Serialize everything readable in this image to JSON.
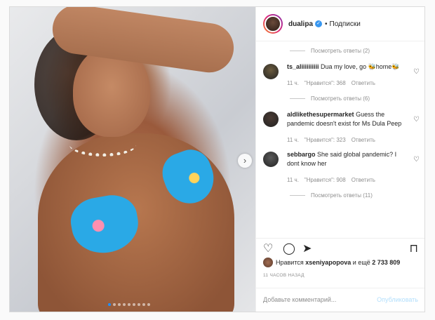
{
  "post": {
    "username": "dualipa",
    "verified_icon": "verified-badge-icon",
    "follow_separator": "•",
    "follow_label": "Подписки",
    "photo_dots": 9,
    "photo_active_index": 0
  },
  "comments": [
    {
      "type": "replies",
      "label": "Посмотреть ответы (2)"
    },
    {
      "type": "comment",
      "author": "ts_aliiiiiiiiii",
      "text": "Dua my love, go 🐝home🐝",
      "time": "11 ч.",
      "likes": "\"Нравится\": 368",
      "reply": "Ответить",
      "avatar_color": "#6b5b3e"
    },
    {
      "type": "replies",
      "label": "Посмотреть ответы (6)"
    },
    {
      "type": "comment",
      "author": "aldlikethesupermarket",
      "text": "Guess the pandemic doesn't exist for Ms Dula Peep",
      "time": "11 ч.",
      "likes": "\"Нравится\": 323",
      "reply": "Ответить",
      "avatar_color": "#4a3a33"
    },
    {
      "type": "comment",
      "author": "sebbargo",
      "text": "She said global pandemic? I dont know her",
      "time": "11 ч.",
      "likes": "\"Нравится\": 908",
      "reply": "Ответить",
      "avatar_color": "#5a5a5a"
    },
    {
      "type": "replies",
      "label": "Посмотреть ответы (11)"
    }
  ],
  "actions": {
    "like_icon": "heart-icon",
    "comment_icon": "comment-icon",
    "share_icon": "share-icon",
    "save_icon": "bookmark-icon"
  },
  "likes": {
    "prefix": "Нравится",
    "user": "xseniyapopova",
    "middle": "и ещё",
    "count": "2 733 809"
  },
  "timestamp": "11 ЧАСОВ НАЗАД",
  "add_comment": {
    "placeholder": "Добавьте комментарий...",
    "post_label": "Опубликовать"
  }
}
